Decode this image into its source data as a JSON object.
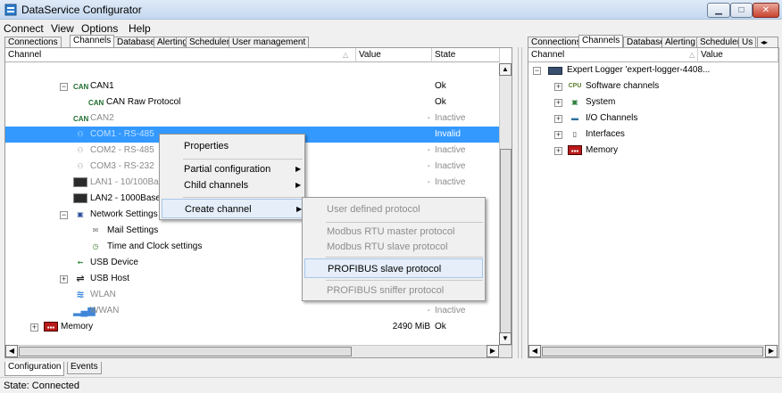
{
  "window": {
    "title": "DataService Configurator"
  },
  "menubar": {
    "items": [
      "Connect",
      "View",
      "Options",
      "Help"
    ]
  },
  "left_tabs": [
    "Connections",
    "Channels",
    "Database",
    "Alerting",
    "Scheduler",
    "User management"
  ],
  "right_tabs": [
    "Connections",
    "Channels",
    "Database",
    "Alerting",
    "Scheduler",
    "Us"
  ],
  "left_table": {
    "headers": {
      "channel": "Channel",
      "value": "Value",
      "state": "State"
    },
    "rows": [
      {
        "label": "CAN1",
        "value": "",
        "state": "Ok"
      },
      {
        "label": "CAN Raw Protocol",
        "value": "",
        "state": "Ok"
      },
      {
        "label": "CAN2",
        "value": "-",
        "state": "Inactive"
      },
      {
        "label": "COM1 - RS-485",
        "value": "-",
        "state": "Invalid"
      },
      {
        "label": "COM2 - RS-485",
        "value": "-",
        "state": "Inactive"
      },
      {
        "label": "COM3 - RS-232",
        "value": "-",
        "state": "Inactive"
      },
      {
        "label": "LAN1 - 10/100Ba",
        "value": "-",
        "state": "Inactive"
      },
      {
        "label": "LAN2 - 1000Base",
        "value": "",
        "state": ""
      },
      {
        "label": "Network Settings",
        "value": "",
        "state": ""
      },
      {
        "label": "Mail Settings",
        "value": "",
        "state": ""
      },
      {
        "label": "Time and Clock settings",
        "value": "",
        "state": ""
      },
      {
        "label": "USB Device",
        "value": "",
        "state": ""
      },
      {
        "label": "USB Host",
        "value": "",
        "state": ""
      },
      {
        "label": "WLAN",
        "value": "",
        "state": ""
      },
      {
        "label": "WWAN",
        "value": "-",
        "state": "Inactive"
      },
      {
        "label": "Memory",
        "value": "2490 MiB",
        "state": "Ok"
      }
    ]
  },
  "right_table": {
    "headers": {
      "channel": "Channel",
      "value": "Value"
    },
    "rows": [
      {
        "label": "Expert Logger 'expert-logger-4408..."
      },
      {
        "label": "Software channels"
      },
      {
        "label": "System"
      },
      {
        "label": "I/O Channels"
      },
      {
        "label": "Interfaces"
      },
      {
        "label": "Memory"
      }
    ]
  },
  "context_menu": {
    "items": [
      {
        "label": "Properties",
        "submenu": false
      },
      {
        "label": "Partial configuration",
        "submenu": true
      },
      {
        "label": "Child channels",
        "submenu": true
      },
      {
        "label": "Create channel",
        "submenu": true
      }
    ]
  },
  "submenu": {
    "items": [
      {
        "label": "User defined protocol",
        "enabled": false
      },
      {
        "label": "Modbus RTU master protocol",
        "enabled": false
      },
      {
        "label": "Modbus RTU slave protocol",
        "enabled": false
      },
      {
        "label": "PROFIBUS slave protocol",
        "enabled": true,
        "highlighted": true
      },
      {
        "label": "PROFIBUS sniffer protocol",
        "enabled": false
      }
    ]
  },
  "bottom_tabs": [
    "Configuration",
    "Events"
  ],
  "status": {
    "text": "State: Connected"
  },
  "colors": {
    "selection": "#3399ff",
    "highlight": "#e5eef9",
    "title_bar": "#dfeaf7"
  }
}
